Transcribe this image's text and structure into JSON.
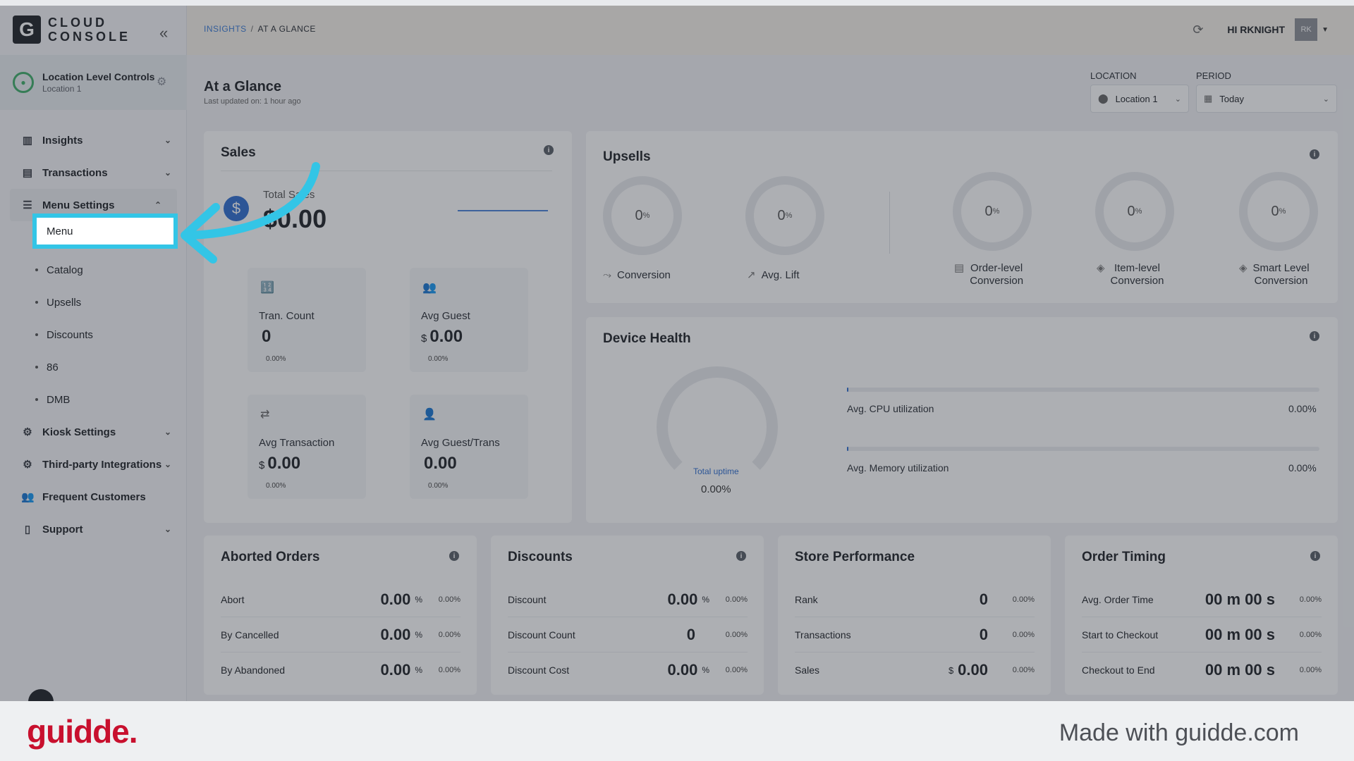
{
  "app": {
    "logo_letter": "G",
    "logo_line1": "CLOUD",
    "logo_line2": "CONSOLE"
  },
  "location_control": {
    "title": "Location Level Controls",
    "subtitle": "Location 1"
  },
  "sidebar": {
    "items": [
      {
        "label": "Insights",
        "icon": "chart-icon"
      },
      {
        "label": "Transactions",
        "icon": "receipt-icon"
      },
      {
        "label": "Menu Settings",
        "icon": "menu-settings-icon"
      },
      {
        "label": "Kiosk Settings",
        "icon": "gear-icon"
      },
      {
        "label": "Third-party Integrations",
        "icon": "gear-icon"
      },
      {
        "label": "Frequent Customers",
        "icon": "users-icon"
      },
      {
        "label": "Support",
        "icon": "support-icon"
      }
    ],
    "menu_sub": [
      "Menu",
      "Catalog",
      "Upsells",
      "Discounts",
      "86",
      "DMB"
    ]
  },
  "topbar": {
    "crumb1": "INSIGHTS",
    "crumb_sep": "/",
    "crumb2": "AT A GLANCE",
    "greeting": "HI RKNIGHT",
    "avatar": "RK"
  },
  "page": {
    "title": "At a Glance",
    "subtitle": "Last updated on: 1 hour ago"
  },
  "filters": {
    "location_label": "LOCATION",
    "location_value": "Location 1",
    "period_label": "PERIOD",
    "period_value": "Today"
  },
  "sales": {
    "title": "Sales",
    "total_label": "Total Sales",
    "total_value": "$0.00",
    "tiles": [
      {
        "label": "Tran. Count",
        "currency": "",
        "value": "0",
        "pct": "0.00%"
      },
      {
        "label": "Avg Guest",
        "currency": "$",
        "value": "0.00",
        "pct": "0.00%"
      },
      {
        "label": "Avg Transaction",
        "currency": "$",
        "value": "0.00",
        "pct": "0.00%"
      },
      {
        "label": "Avg Guest/Trans",
        "currency": "",
        "value": "0.00",
        "pct": "0.00%"
      }
    ]
  },
  "upsells": {
    "title": "Upsells",
    "unit": "%",
    "items": [
      {
        "value": "0",
        "label": "Conversion",
        "label2": ""
      },
      {
        "value": "0",
        "label": "Avg. Lift",
        "label2": ""
      },
      {
        "value": "0",
        "label": "Order-level",
        "label2": "Conversion"
      },
      {
        "value": "0",
        "label": "Item-level",
        "label2": "Conversion"
      },
      {
        "value": "0",
        "label": "Smart Level",
        "label2": "Conversion"
      }
    ]
  },
  "device_health": {
    "title": "Device Health",
    "uptime_label": "Total uptime",
    "uptime_value": "0.00%",
    "cpu_label": "Avg. CPU utilization",
    "cpu_value": "0.00%",
    "cpu_fraction": 0.0,
    "mem_label": "Avg. Memory utilization",
    "mem_value": "0.00%",
    "mem_fraction": 0.0
  },
  "aborted_orders": {
    "title": "Aborted Orders",
    "rows": [
      {
        "label": "Abort",
        "value": "0.00",
        "unit": "%",
        "pct": "0.00%"
      },
      {
        "label": "By Cancelled",
        "value": "0.00",
        "unit": "%",
        "pct": "0.00%"
      },
      {
        "label": "By Abandoned",
        "value": "0.00",
        "unit": "%",
        "pct": "0.00%"
      }
    ]
  },
  "discounts": {
    "title": "Discounts",
    "rows": [
      {
        "label": "Discount",
        "value": "0.00",
        "unit": "%",
        "pct": "0.00%"
      },
      {
        "label": "Discount Count",
        "value": "0",
        "unit": "",
        "pct": "0.00%"
      },
      {
        "label": "Discount Cost",
        "value": "0.00",
        "unit": "%",
        "pct": "0.00%"
      }
    ]
  },
  "store_performance": {
    "title": "Store Performance",
    "rows": [
      {
        "label": "Rank",
        "value": "0",
        "currency": "",
        "pct": "0.00%"
      },
      {
        "label": "Transactions",
        "value": "0",
        "currency": "",
        "pct": "0.00%"
      },
      {
        "label": "Sales",
        "value": "0.00",
        "currency": "$",
        "pct": "0.00%"
      }
    ]
  },
  "order_timing": {
    "title": "Order Timing",
    "rows": [
      {
        "label": "Avg. Order Time",
        "value": "00 m 00 s",
        "pct": "0.00%"
      },
      {
        "label": "Start to Checkout",
        "value": "00 m 00 s",
        "pct": "0.00%"
      },
      {
        "label": "Checkout to End",
        "value": "00 m 00 s",
        "pct": "0.00%"
      }
    ]
  },
  "footer": {
    "brand": "guidde.",
    "made_with": "Made with guidde.com"
  },
  "colors": {
    "highlight": "#33c5e6",
    "brand_red": "#c8102e",
    "accent_blue": "#2f6fd1"
  }
}
